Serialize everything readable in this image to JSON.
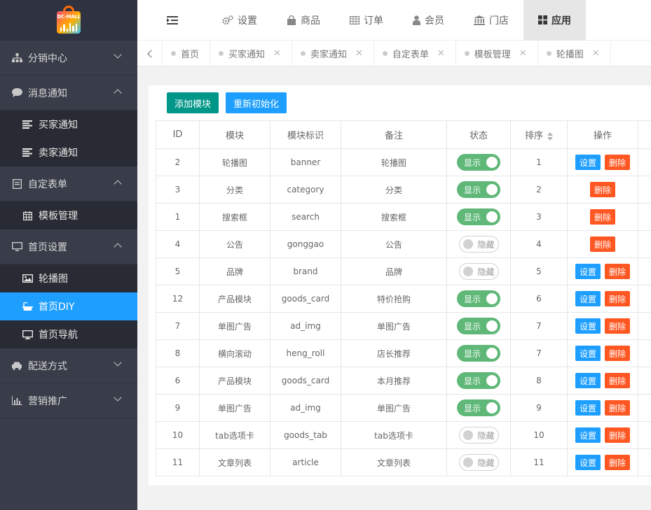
{
  "logo": {
    "text": "DC-MALL"
  },
  "sidebar": {
    "groups": [
      {
        "label": "分销中心",
        "icon": "sitemap-icon",
        "expanded": false,
        "items": []
      },
      {
        "label": "消息通知",
        "icon": "comment-icon",
        "expanded": true,
        "items": [
          {
            "label": "买家通知",
            "icon": "list-icon"
          },
          {
            "label": "卖家通知",
            "icon": "list-icon"
          }
        ]
      },
      {
        "label": "自定表单",
        "icon": "form-icon",
        "expanded": true,
        "items": [
          {
            "label": "模板管理",
            "icon": "calendar-icon"
          }
        ]
      },
      {
        "label": "首页设置",
        "icon": "monitor-icon",
        "expanded": true,
        "items": [
          {
            "label": "轮播图",
            "icon": "image-icon"
          },
          {
            "label": "首页DIY",
            "icon": "bath-icon",
            "active": true
          },
          {
            "label": "首页导航",
            "icon": "desktop-icon"
          }
        ]
      },
      {
        "label": "配送方式",
        "icon": "car-icon",
        "expanded": false,
        "items": []
      },
      {
        "label": "营销推广",
        "icon": "bar-chart-icon",
        "expanded": false,
        "items": []
      }
    ]
  },
  "topnav": {
    "items": [
      {
        "label": "设置",
        "icon": "gears-icon"
      },
      {
        "label": "商品",
        "icon": "shopping-bag-icon"
      },
      {
        "label": "订单",
        "icon": "table-icon"
      },
      {
        "label": "会员",
        "icon": "user-icon"
      },
      {
        "label": "门店",
        "icon": "bank-icon"
      },
      {
        "label": "应用",
        "icon": "grid-icon",
        "active": true
      }
    ]
  },
  "tabs": [
    {
      "label": "首页",
      "closable": false
    },
    {
      "label": "买家通知",
      "closable": true
    },
    {
      "label": "卖家通知",
      "closable": true
    },
    {
      "label": "自定表单",
      "closable": true
    },
    {
      "label": "模板管理",
      "closable": true
    },
    {
      "label": "轮播图",
      "closable": true
    }
  ],
  "toolbar": {
    "add_label": "添加模块",
    "reinit_label": "重新初始化"
  },
  "table": {
    "headers": [
      "ID",
      "模块",
      "模块标识",
      "备注",
      "状态",
      "排序",
      "操作"
    ],
    "switch_on": "显示",
    "switch_off": "隐藏",
    "set_label": "设置",
    "del_label": "删除",
    "rows": [
      {
        "id": "2",
        "module": "轮播图",
        "key": "banner",
        "note": "轮播图",
        "on": true,
        "sort": "1",
        "settable": true
      },
      {
        "id": "3",
        "module": "分类",
        "key": "category",
        "note": "分类",
        "on": true,
        "sort": "2",
        "settable": false
      },
      {
        "id": "1",
        "module": "搜索框",
        "key": "search",
        "note": "搜索框",
        "on": true,
        "sort": "3",
        "settable": false
      },
      {
        "id": "4",
        "module": "公告",
        "key": "gonggao",
        "note": "公告",
        "on": false,
        "sort": "4",
        "settable": false
      },
      {
        "id": "5",
        "module": "品牌",
        "key": "brand",
        "note": "品牌",
        "on": false,
        "sort": "5",
        "settable": true
      },
      {
        "id": "12",
        "module": "产品模块",
        "key": "goods_card",
        "note": "特价抢购",
        "on": true,
        "sort": "6",
        "settable": true
      },
      {
        "id": "7",
        "module": "单图广告",
        "key": "ad_img",
        "note": "单图广告",
        "on": true,
        "sort": "7",
        "settable": true
      },
      {
        "id": "8",
        "module": "横向滚动",
        "key": "heng_roll",
        "note": "店长推荐",
        "on": true,
        "sort": "7",
        "settable": true
      },
      {
        "id": "6",
        "module": "产品模块",
        "key": "goods_card",
        "note": "本月推荐",
        "on": true,
        "sort": "8",
        "settable": true
      },
      {
        "id": "9",
        "module": "单图广告",
        "key": "ad_img",
        "note": "单图广告",
        "on": true,
        "sort": "9",
        "settable": true
      },
      {
        "id": "10",
        "module": "tab选项卡",
        "key": "goods_tab",
        "note": "tab选项卡",
        "on": false,
        "sort": "10",
        "settable": true
      },
      {
        "id": "11",
        "module": "文章列表",
        "key": "article",
        "note": "文章列表",
        "on": false,
        "sort": "11",
        "settable": true
      }
    ]
  },
  "colors": {
    "sidebar_bg": "#393d49",
    "active_blue": "#1e9fff",
    "green": "#009688",
    "switch_on": "#5fb878",
    "danger": "#ff5722"
  }
}
